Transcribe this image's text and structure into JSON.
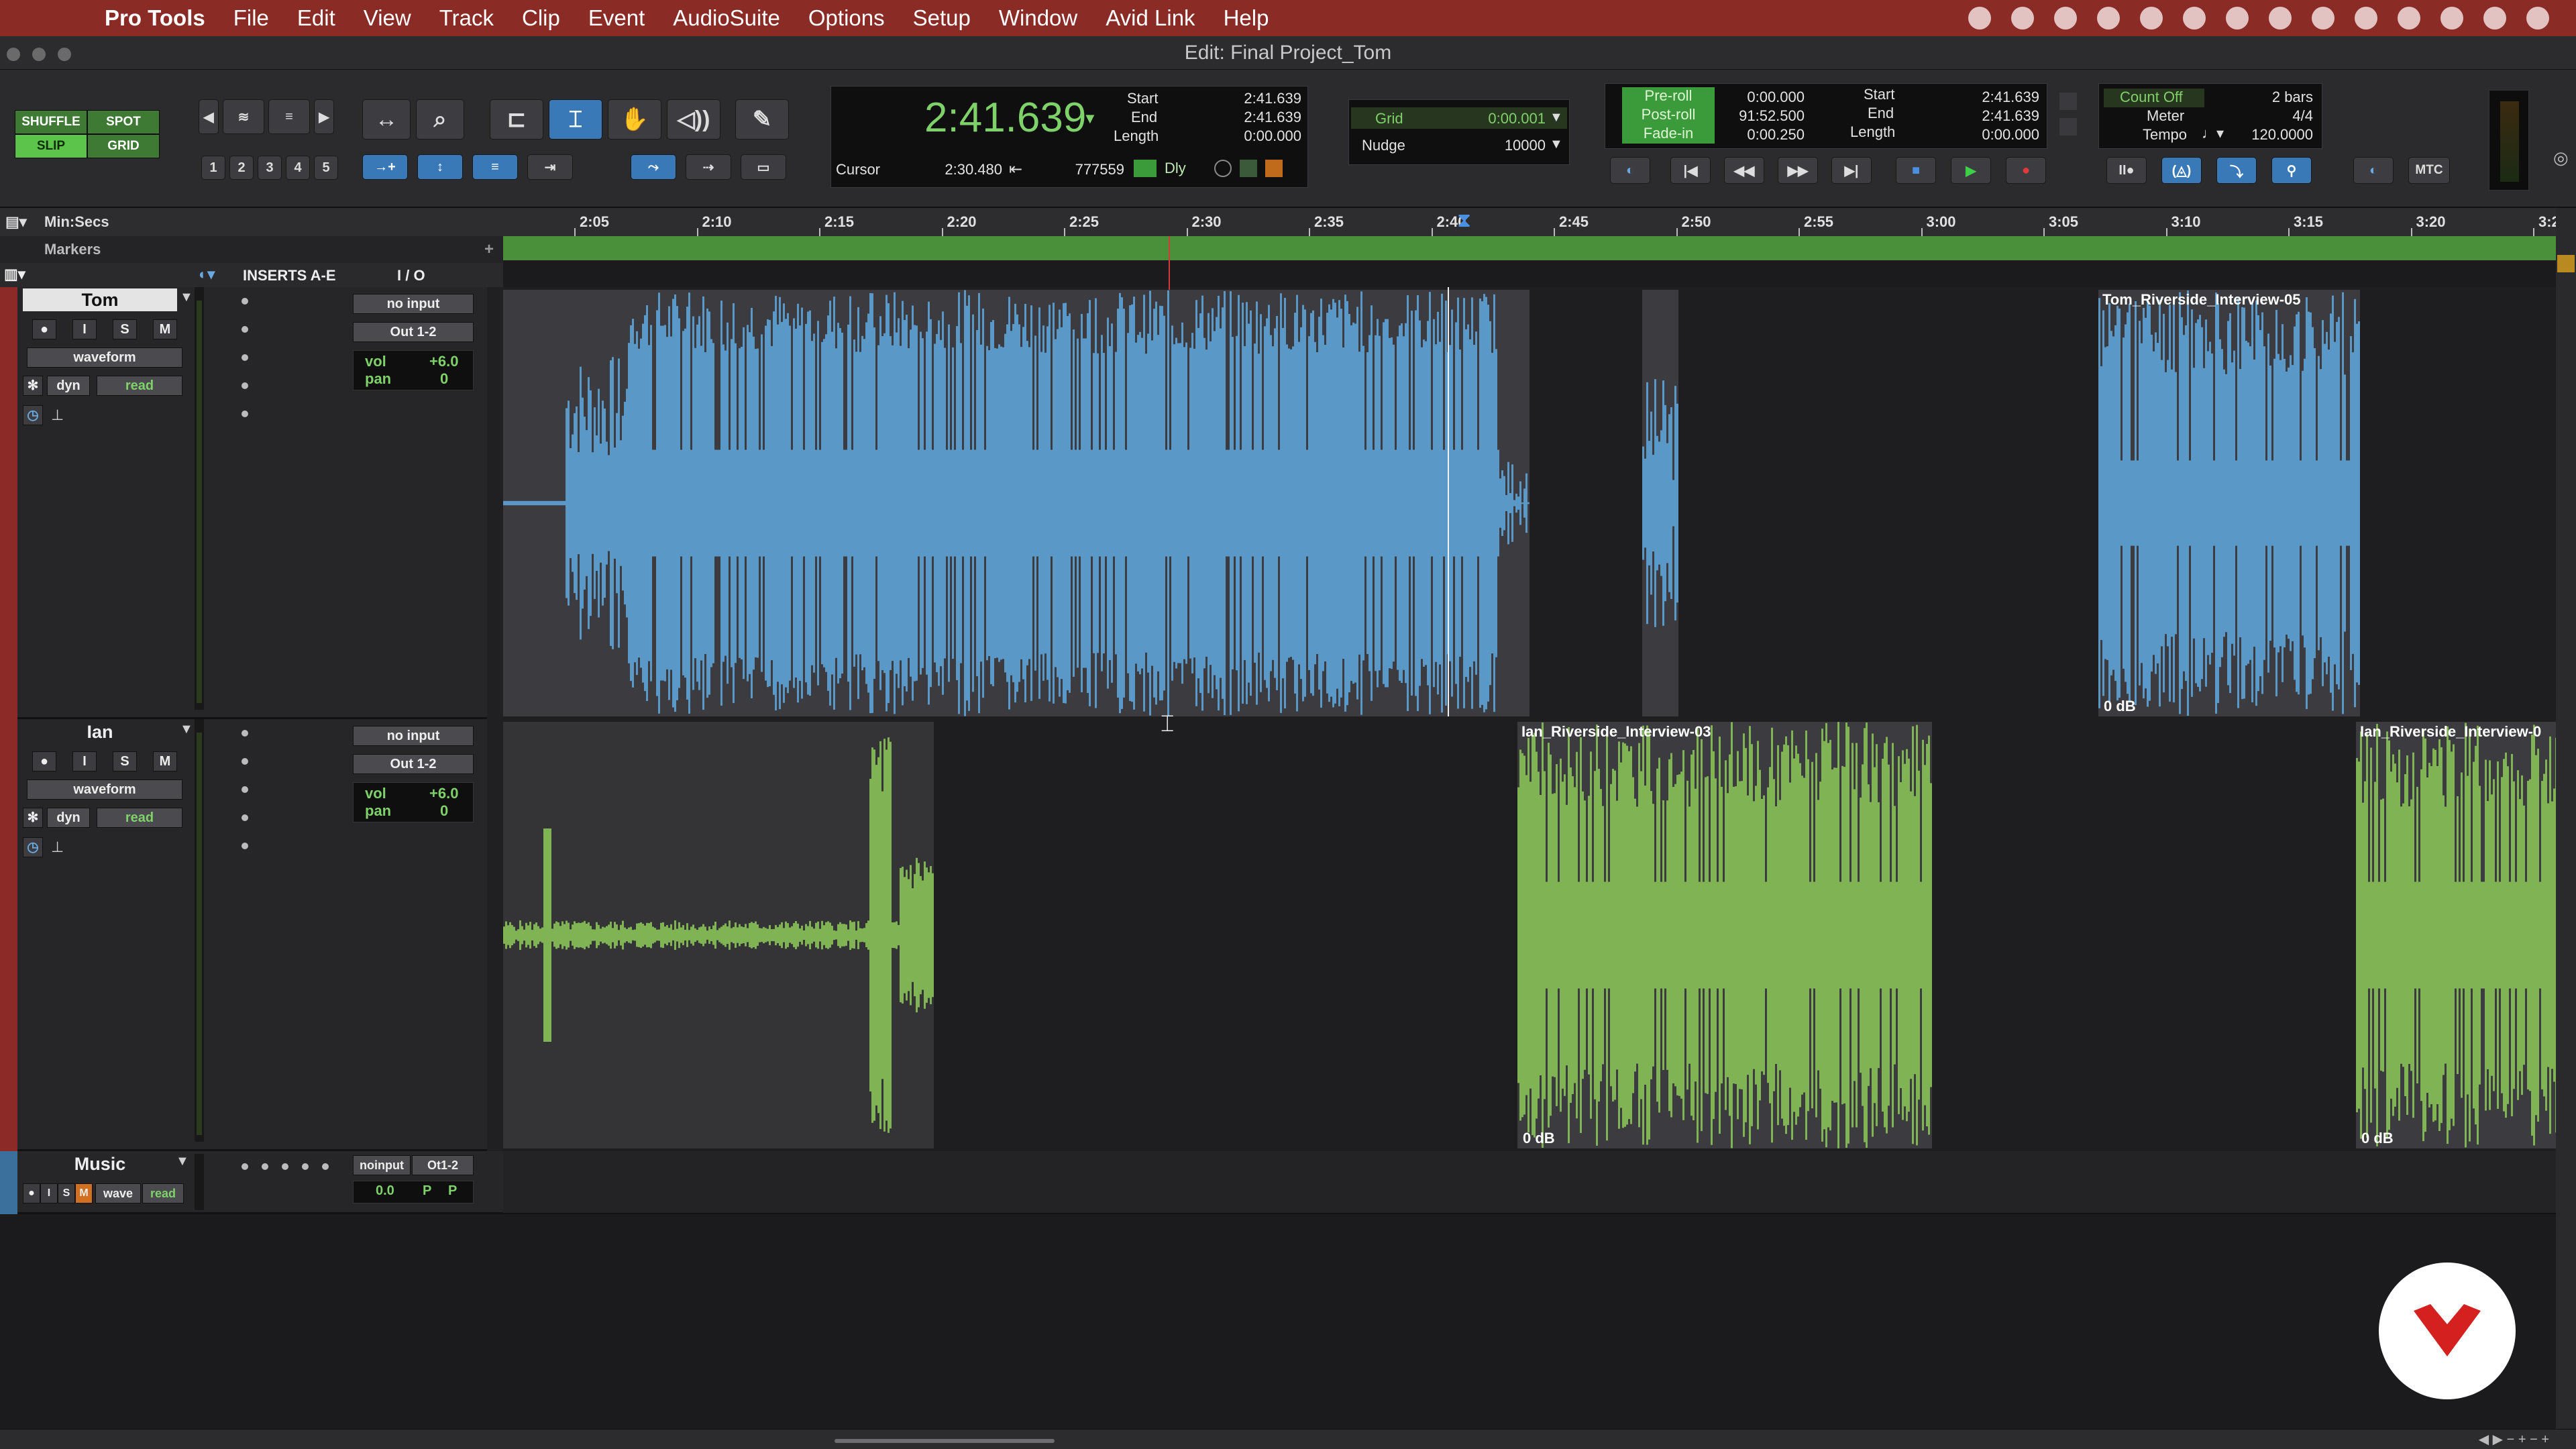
{
  "menubar": {
    "items": [
      "Pro Tools",
      "File",
      "Edit",
      "View",
      "Track",
      "Clip",
      "Event",
      "AudioSuite",
      "Options",
      "Setup",
      "Window",
      "Avid Link",
      "Help"
    ]
  },
  "window": {
    "title": "Edit: Final Project_Tom"
  },
  "toolbar": {
    "modes": {
      "shuffle": "SHUFFLE",
      "spot": "SPOT",
      "slip": "SLIP",
      "grid": "GRID"
    },
    "zoom_presets": [
      "1",
      "2",
      "3",
      "4",
      "5"
    ],
    "main_counter": "2:41.639",
    "sel": {
      "start_label": "Start",
      "end_label": "End",
      "length_label": "Length",
      "start": "2:41.639",
      "end": "2:41.639",
      "length": "0:00.000"
    },
    "cursor_label": "Cursor",
    "cursor_value": "2:30.480",
    "sample_value": "777559",
    "dly": "Dly",
    "grid": {
      "label": "Grid",
      "value": "0:00.001",
      "nudge_label": "Nudge",
      "nudge_value": "10000"
    },
    "roll": {
      "preroll_label": "Pre-roll",
      "postroll_label": "Post-roll",
      "fadein_label": "Fade-in",
      "preroll": "0:00.000",
      "postroll": "91:52.500",
      "fadein": "0:00.250"
    },
    "sel2": {
      "start_label": "Start",
      "end_label": "End",
      "length_label": "Length",
      "start": "2:41.639",
      "end": "2:41.639",
      "length": "0:00.000"
    },
    "count": {
      "count_label": "Count Off",
      "bars": "2 bars",
      "meter_label": "Meter",
      "meter": "4/4",
      "tempo_label": "Tempo",
      "tempo": "120.0000"
    },
    "mtc": "MTC"
  },
  "ruler": {
    "label": "Min:Secs",
    "markers_label": "Markers",
    "ticks": [
      "2:05",
      "2:10",
      "2:15",
      "2:20",
      "2:25",
      "2:30",
      "2:35",
      "2:40",
      "2:45",
      "2:50",
      "2:55",
      "3:00",
      "3:05",
      "3:10",
      "3:15",
      "3:20",
      "3:2"
    ]
  },
  "columns": {
    "inserts": "INSERTS A-E",
    "io": "I / O"
  },
  "tracks": [
    {
      "name": "Tom",
      "input": "no input",
      "output": "Out 1-2",
      "view": "waveform",
      "dyn": "dyn",
      "auto": "read",
      "vol_label": "vol",
      "vol": "+6.0",
      "pan_label": "pan",
      "pan": "0",
      "color": "#5a98c8"
    },
    {
      "name": "Ian",
      "input": "no input",
      "output": "Out 1-2",
      "view": "waveform",
      "dyn": "dyn",
      "auto": "read",
      "vol_label": "vol",
      "vol": "+6.0",
      "pan_label": "pan",
      "pan": "0",
      "color": "#7fb354"
    }
  ],
  "music": {
    "name": "Music",
    "input": "noinput",
    "output": "Ot1-2",
    "view": "wave",
    "auto": "read",
    "vol": "0.0",
    "p1": "P",
    "p2": "P"
  },
  "clips": {
    "tom_interview_05": "Tom_Riverside_Interview-05",
    "ian_interview_03": "Ian_Riverside_Interview-03",
    "ian_interview_0x": "Ian_Riverside_Interview-0",
    "gain": "0 dB"
  },
  "buttons": {
    "i": "I",
    "s": "S",
    "m": "M"
  }
}
